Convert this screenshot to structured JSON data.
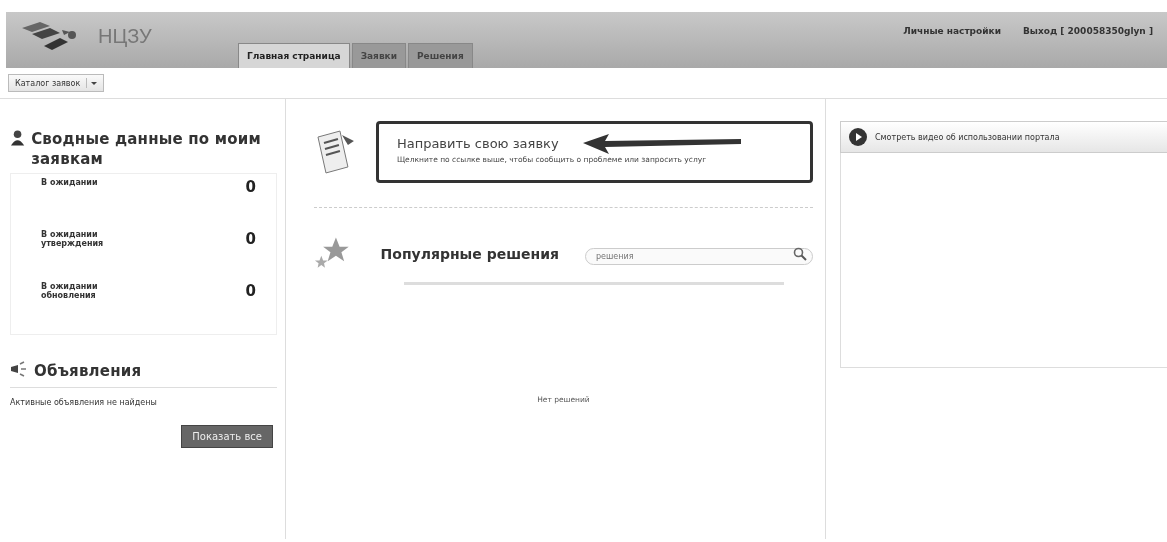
{
  "header": {
    "logo_text": "НЦЗУ",
    "links": [
      "Личные настройки",
      "Выход [ 200058350glyn ]"
    ]
  },
  "tabs": [
    {
      "label": "Главная страница",
      "selected": true
    },
    {
      "label": "Заявки",
      "selected": false
    },
    {
      "label": "Решения",
      "selected": false
    }
  ],
  "catalog_dropdown": {
    "label": "Каталог заявок"
  },
  "summary": {
    "title": "Сводные данные по моим заявкам",
    "rows": [
      {
        "label": "В ожидании",
        "count": "0"
      },
      {
        "label": "В ожидании утверждения",
        "count": "0"
      },
      {
        "label": "В ожидании обновления",
        "count": "0"
      }
    ]
  },
  "announcements": {
    "title": "Объявления",
    "empty_text": "Активные объявления не найдены",
    "button": "Показать все"
  },
  "request": {
    "title": "Направить свою заявку",
    "description": "Щелкните по ссылке выше, чтобы сообщить о проблеме или запросить услуг"
  },
  "popular": {
    "title": "Популярные решения",
    "search_placeholder": "решения",
    "empty_text": "Нет решений"
  },
  "video": {
    "label": "Смотреть видео об использовании портала"
  }
}
